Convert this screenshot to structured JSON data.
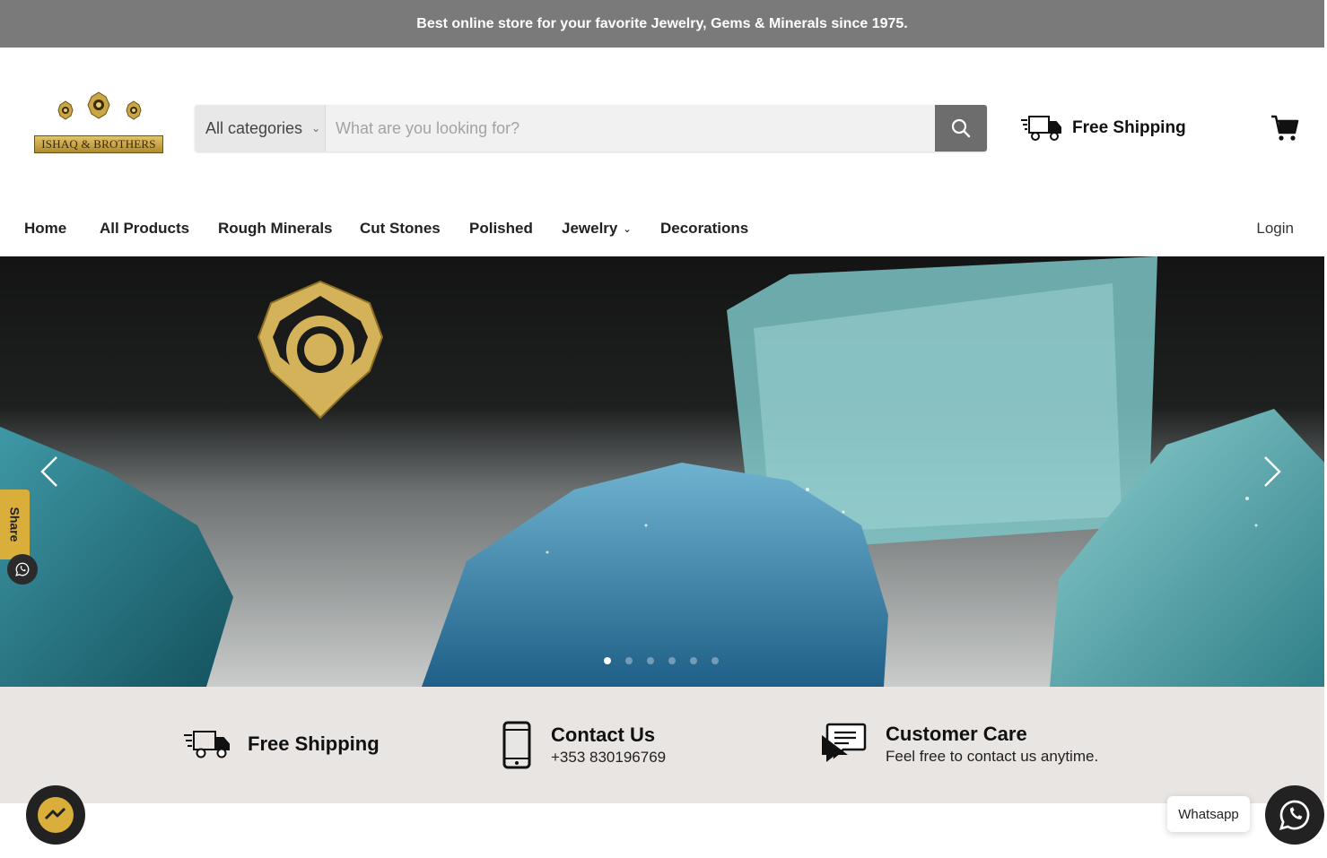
{
  "announcement": {
    "text": "Best online store for your favorite Jewelry, Gems & Minerals since 1975."
  },
  "brand": {
    "logo_text": "ISHAQ & BROTHERS",
    "gold": "#d4b25a"
  },
  "search": {
    "category_label": "All categories",
    "placeholder": "What are you looking for?",
    "value": ""
  },
  "header": {
    "shipping_label": "Free Shipping",
    "cart_icon": "cart-icon"
  },
  "nav": {
    "items": [
      {
        "label": "Home"
      },
      {
        "label": "All Products"
      },
      {
        "label": "Rough Minerals"
      },
      {
        "label": "Cut Stones"
      },
      {
        "label": "Polished"
      },
      {
        "label": "Jewelry",
        "has_dropdown": true
      },
      {
        "label": "Decorations"
      }
    ],
    "login_label": "Login"
  },
  "hero": {
    "slide_count": 6,
    "active_slide": 1
  },
  "share": {
    "label": "Share"
  },
  "features": [
    {
      "title": "Free Shipping",
      "subtitle": "",
      "icon": "delivery-truck-icon"
    },
    {
      "title": "Contact Us",
      "subtitle": "+353 830196769",
      "icon": "phone-icon"
    },
    {
      "title": "Customer Care",
      "subtitle": "Feel free to contact us anytime.",
      "icon": "chat-bubble-icon"
    }
  ],
  "whatsapp": {
    "label": "Whatsapp"
  },
  "colors": {
    "announcement_bg": "#7a7a7a",
    "features_bg": "#e9e5e3",
    "share_tab": "#d9ae3b"
  }
}
